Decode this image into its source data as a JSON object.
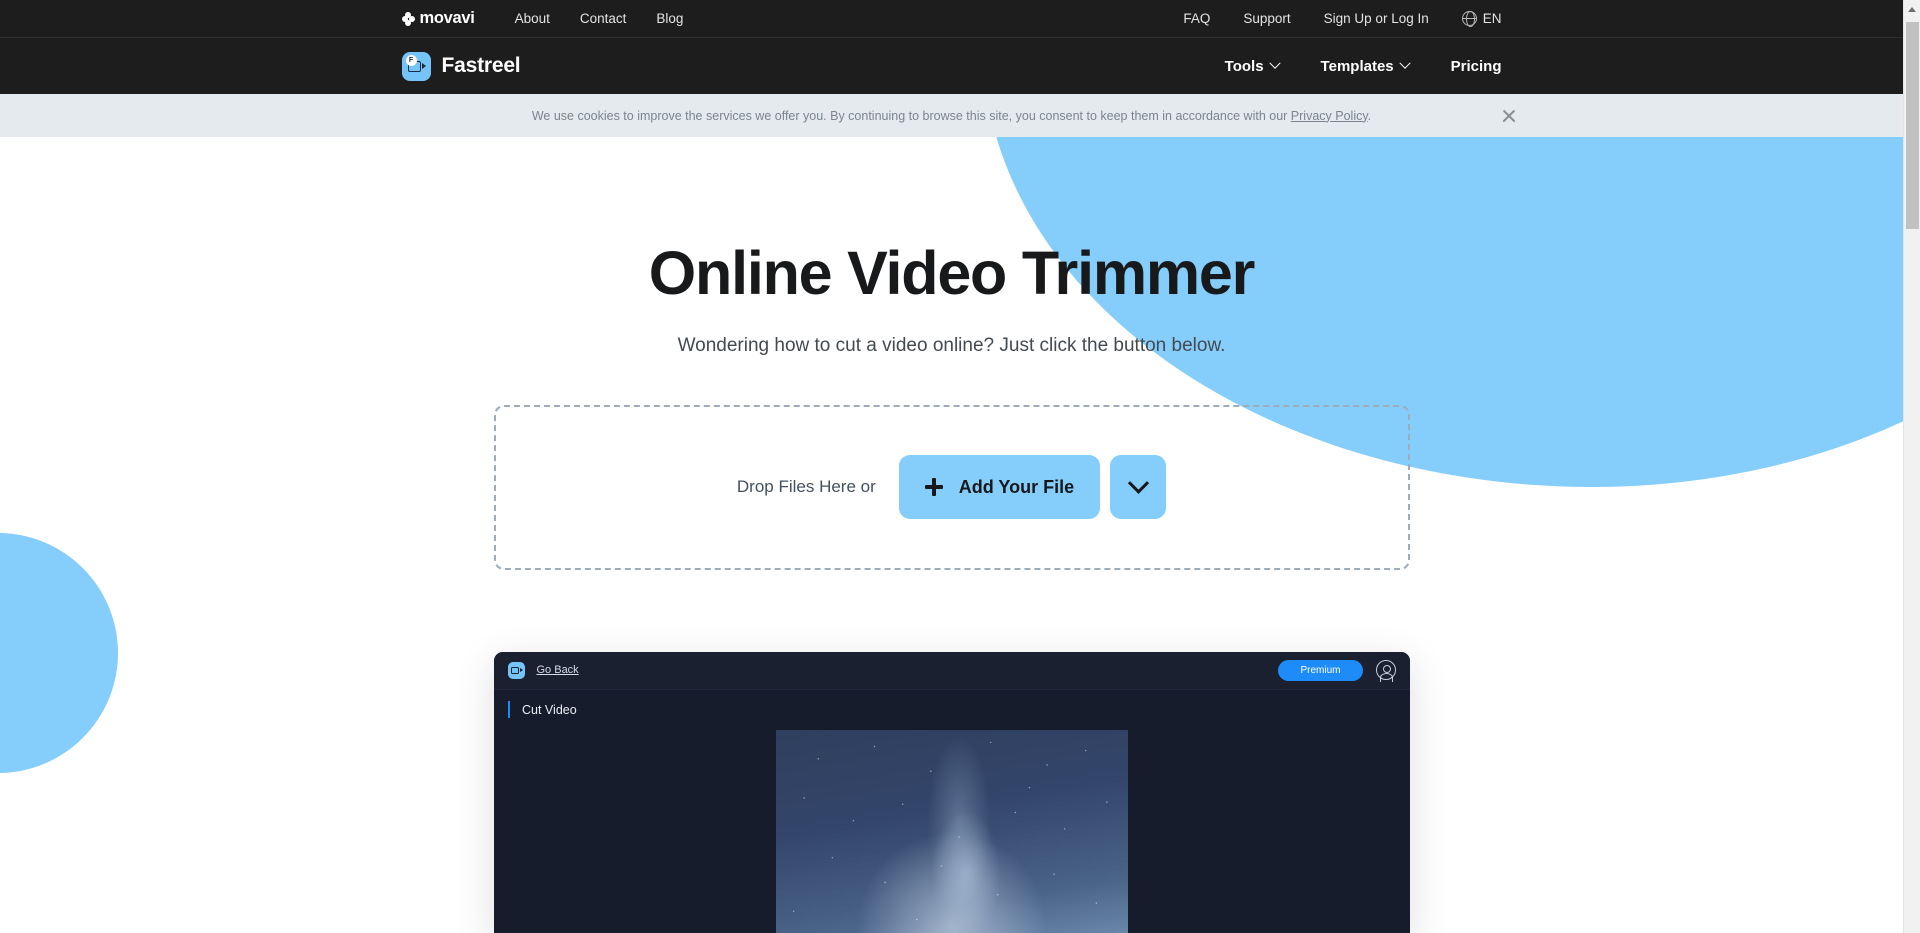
{
  "utility_bar": {
    "brand": "movavi",
    "left_links": [
      "About",
      "Contact",
      "Blog"
    ],
    "right_links": [
      "FAQ",
      "Support",
      "Sign Up or Log In"
    ],
    "language": "EN",
    "globe_icon": "globe-icon"
  },
  "header": {
    "brand_name": "Fastreel",
    "brand_badge": "F",
    "nav": [
      {
        "label": "Tools",
        "has_chevron": true
      },
      {
        "label": "Templates",
        "has_chevron": true
      },
      {
        "label": "Pricing",
        "has_chevron": false
      }
    ]
  },
  "cookie_banner": {
    "text_before_link": "We use cookies to improve the services we offer you. By continuing to browse this site, you consent to keep them in accordance with our ",
    "link_text": "Privacy Policy",
    "text_after_link": ".",
    "close_icon": "close-icon",
    "background": "#e5eaee"
  },
  "hero": {
    "title": "Online Video Trimmer",
    "subtitle": "Wondering how to cut a video online? Just click the button below.",
    "accent_color": "#85cdfa"
  },
  "dropzone": {
    "label": "Drop Files Here or",
    "add_button_label": "Add Your File",
    "plus_icon": "plus-icon",
    "dropdown_icon": "chevron-down-icon",
    "border_color": "#9eacba",
    "button_color": "#85cdfa"
  },
  "app_preview": {
    "logo_icon": "fastreel-logo-icon",
    "go_back_label": "Go Back",
    "premium_label": "Premium",
    "premium_color": "#1d8cf8",
    "avatar_icon": "user-avatar-icon",
    "section_title": "Cut Video",
    "video_thumbnail_alt": "night-sky-milky-way-video-preview"
  },
  "scrollbar": {
    "up_arrow_icon": "scroll-up-arrow-icon",
    "thumb": "scroll-thumb"
  }
}
